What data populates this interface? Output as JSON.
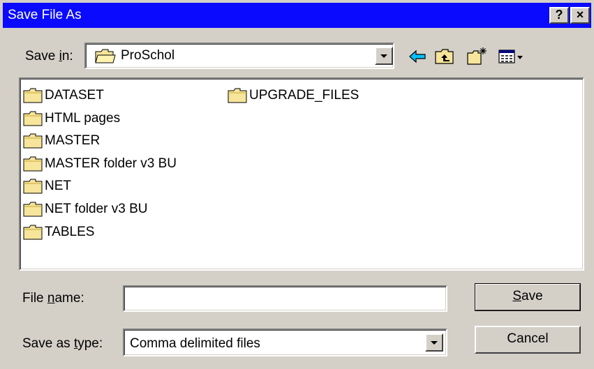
{
  "window": {
    "title": "Save File As"
  },
  "title_buttons": {
    "help": "?",
    "close": "×"
  },
  "location": {
    "label_prefix": "Save ",
    "label_underlined": "i",
    "label_suffix": "n:",
    "current_folder": "ProSchol"
  },
  "toolbar": [
    "back-icon",
    "up-one-level-icon",
    "new-folder-icon",
    "view-menu-icon"
  ],
  "files": {
    "column1": [
      "DATASET",
      "HTML pages",
      "MASTER",
      "MASTER folder v3 BU",
      "NET",
      "NET folder v3 BU",
      "TABLES"
    ],
    "column2": [
      "UPGRADE_FILES"
    ]
  },
  "file_name": {
    "label_prefix": "File ",
    "label_underlined": "n",
    "label_suffix": "ame:",
    "value": ""
  },
  "file_type": {
    "label_prefix": "Save as ",
    "label_underlined": "t",
    "label_suffix": "ype:",
    "value": "Comma delimited files"
  },
  "buttons": {
    "save_underlined": "S",
    "save_rest": "ave",
    "cancel": "Cancel"
  },
  "colors": {
    "titlebar": "#0a0aff",
    "face": "#d4d0c8",
    "folder": "#f6e59a"
  }
}
